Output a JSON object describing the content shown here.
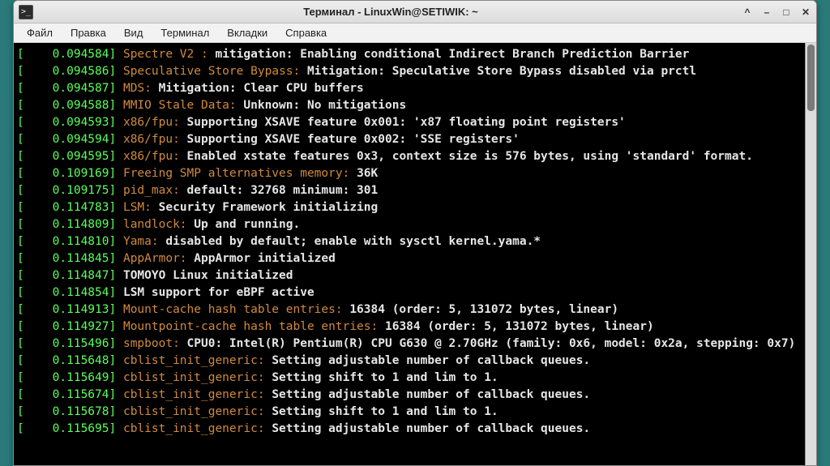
{
  "window": {
    "title": "Терминал - LinuxWin@SETIWIK: ~"
  },
  "menu": {
    "file": "Файл",
    "edit": "Правка",
    "view": "Вид",
    "terminal": "Терминал",
    "tabs": "Вкладки",
    "help": "Справка"
  },
  "lines": [
    {
      "ts": "0.094584",
      "kw": "Spectre V2 :",
      "msg": "mitigation: Enabling conditional Indirect Branch Prediction Barrier"
    },
    {
      "ts": "0.094586",
      "kw": "Speculative Store Bypass:",
      "msg": "Mitigation: Speculative Store Bypass disabled via prctl"
    },
    {
      "ts": "0.094587",
      "kw": "MDS:",
      "msg": "Mitigation: Clear CPU buffers"
    },
    {
      "ts": "0.094588",
      "kw": "MMIO Stale Data:",
      "msg": "Unknown: No mitigations"
    },
    {
      "ts": "0.094593",
      "kw": "x86/fpu:",
      "msg": "Supporting XSAVE feature 0x001: 'x87 floating point registers'"
    },
    {
      "ts": "0.094594",
      "kw": "x86/fpu:",
      "msg": "Supporting XSAVE feature 0x002: 'SSE registers'"
    },
    {
      "ts": "0.094595",
      "kw": "x86/fpu:",
      "msg": "Enabled xstate features 0x3, context size is 576 bytes, using 'standard' format."
    },
    {
      "ts": "0.109169",
      "kw": "Freeing SMP alternatives memory:",
      "msg": "36K"
    },
    {
      "ts": "0.109175",
      "kw": "pid_max:",
      "msg": "default: 32768 minimum: 301"
    },
    {
      "ts": "0.114783",
      "kw": "LSM:",
      "msg": "Security Framework initializing"
    },
    {
      "ts": "0.114809",
      "kw": "landlock:",
      "msg": "Up and running."
    },
    {
      "ts": "0.114810",
      "kw": "Yama:",
      "msg": "disabled by default; enable with sysctl kernel.yama.*"
    },
    {
      "ts": "0.114845",
      "kw": "AppArmor:",
      "msg": "AppArmor initialized"
    },
    {
      "ts": "0.114847",
      "kw": "",
      "msg": "TOMOYO Linux initialized"
    },
    {
      "ts": "0.114854",
      "kw": "",
      "msg": "LSM support for eBPF active"
    },
    {
      "ts": "0.114913",
      "kw": "Mount-cache hash table entries:",
      "msg": "16384 (order: 5, 131072 bytes, linear)"
    },
    {
      "ts": "0.114927",
      "kw": "Mountpoint-cache hash table entries:",
      "msg": "16384 (order: 5, 131072 bytes, linear)"
    },
    {
      "ts": "0.115496",
      "kw": "smpboot:",
      "msg": "CPU0: Intel(R) Pentium(R) CPU G630 @ 2.70GHz (family: 0x6, model: 0x2a, stepping: 0x7)",
      "wrap": true
    },
    {
      "ts": "0.115648",
      "kw": "cblist_init_generic:",
      "msg": "Setting adjustable number of callback queues."
    },
    {
      "ts": "0.115649",
      "kw": "cblist_init_generic:",
      "msg": "Setting shift to 1 and lim to 1."
    },
    {
      "ts": "0.115674",
      "kw": "cblist_init_generic:",
      "msg": "Setting adjustable number of callback queues."
    },
    {
      "ts": "0.115678",
      "kw": "cblist_init_generic:",
      "msg": "Setting shift to 1 and lim to 1."
    },
    {
      "ts": "0.115695",
      "kw": "cblist_init_generic:",
      "msg": "Setting adjustable number of callback queues."
    }
  ]
}
